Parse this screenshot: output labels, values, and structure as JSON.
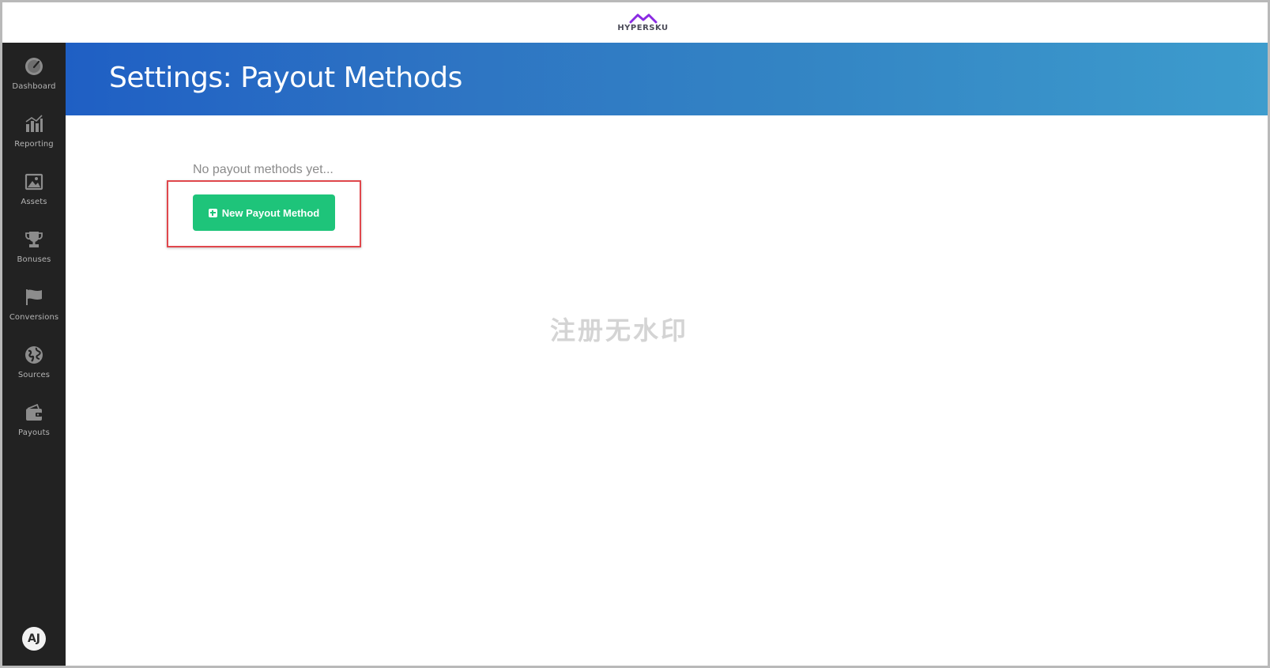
{
  "brand": {
    "name": "HYPERSKU",
    "logo_color": "#8a2be2"
  },
  "sidebar": {
    "items": [
      {
        "label": "Dashboard",
        "icon": "dashboard-gauge-icon"
      },
      {
        "label": "Reporting",
        "icon": "bar-chart-icon"
      },
      {
        "label": "Assets",
        "icon": "image-icon"
      },
      {
        "label": "Bonuses",
        "icon": "trophy-icon"
      },
      {
        "label": "Conversions",
        "icon": "flag-icon"
      },
      {
        "label": "Sources",
        "icon": "globe-icon"
      },
      {
        "label": "Payouts",
        "icon": "wallet-icon"
      }
    ],
    "user_initials": "AJ"
  },
  "header": {
    "title": "Settings: Payout Methods"
  },
  "main": {
    "empty_message": "No payout methods yet...",
    "new_button_label": "New Payout Method",
    "new_button_icon": "plus-square-icon",
    "button_color": "#1ec47a"
  },
  "watermark": "注册无水印"
}
